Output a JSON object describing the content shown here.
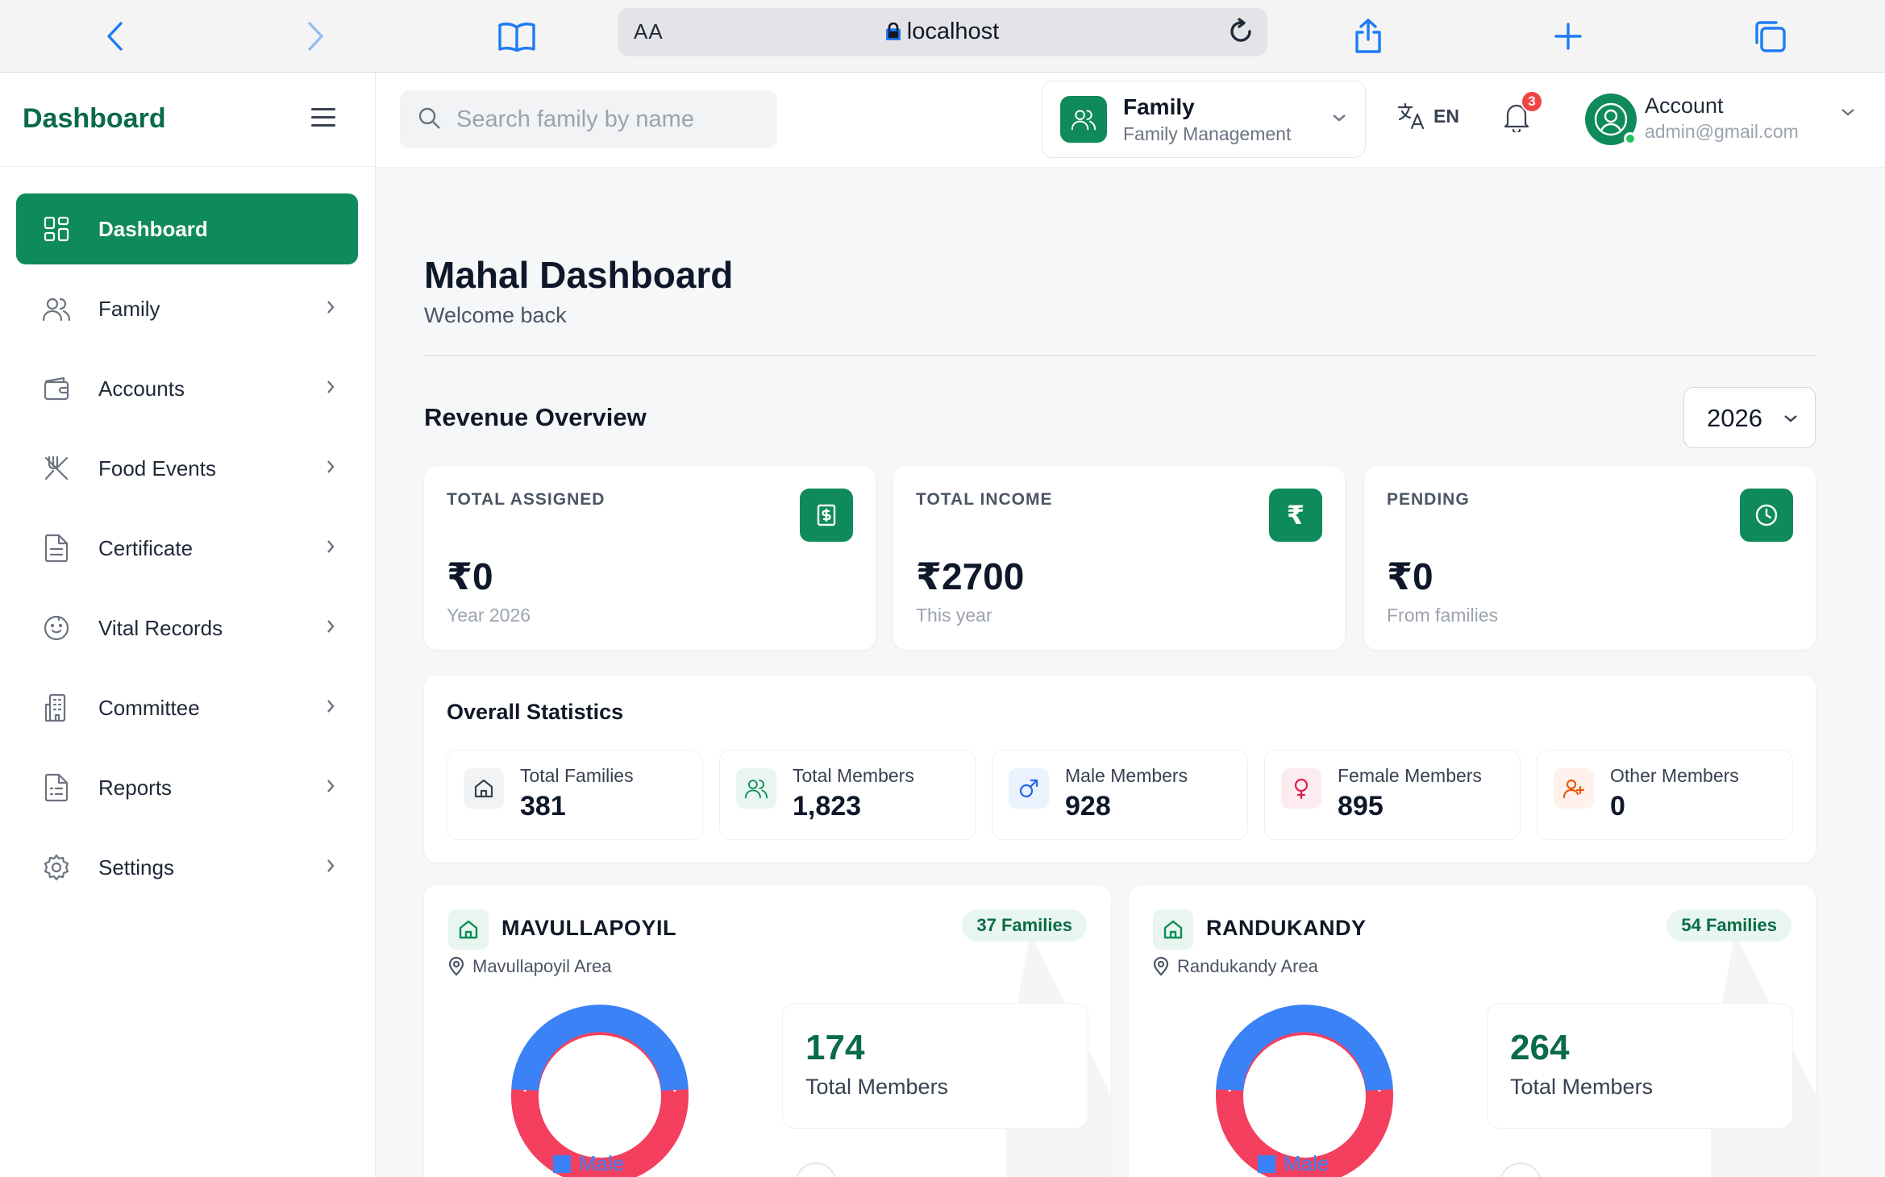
{
  "browser": {
    "aa_label": "AA",
    "url": "localhost"
  },
  "sidebar": {
    "brand": "Dashboard",
    "items": [
      {
        "label": "Dashboard",
        "icon": "grid-icon",
        "active": true
      },
      {
        "label": "Family",
        "icon": "users-icon"
      },
      {
        "label": "Accounts",
        "icon": "wallet-icon"
      },
      {
        "label": "Food Events",
        "icon": "utensils-icon"
      },
      {
        "label": "Certificate",
        "icon": "document-icon"
      },
      {
        "label": "Vital Records",
        "icon": "baby-icon"
      },
      {
        "label": "Committee",
        "icon": "building-icon"
      },
      {
        "label": "Reports",
        "icon": "report-icon"
      },
      {
        "label": "Settings",
        "icon": "gear-icon"
      }
    ]
  },
  "header": {
    "search_placeholder": "Search family by name",
    "module_title": "Family",
    "module_subtitle": "Family Management",
    "language": "EN",
    "notification_count": "3",
    "account_name": "Account",
    "account_email": "admin@gmail.com"
  },
  "page": {
    "title": "Mahal Dashboard",
    "subtitle": "Welcome back"
  },
  "revenue": {
    "title": "Revenue Overview",
    "year": "2026",
    "cards": [
      {
        "label": "TOTAL ASSIGNED",
        "value": "₹0",
        "sub": "Year 2026",
        "icon": "invoice-icon"
      },
      {
        "label": "TOTAL INCOME",
        "value": "₹2700",
        "sub": "This year",
        "icon": "rupee-icon"
      },
      {
        "label": "PENDING",
        "value": "₹0",
        "sub": "From families",
        "icon": "clock-icon"
      }
    ]
  },
  "stats": {
    "title": "Overall Statistics",
    "items": [
      {
        "label": "Total Families",
        "value": "381",
        "icon": "home-icon"
      },
      {
        "label": "Total Members",
        "value": "1,823",
        "icon": "users-icon"
      },
      {
        "label": "Male Members",
        "value": "928",
        "icon": "male-icon"
      },
      {
        "label": "Female Members",
        "value": "895",
        "icon": "female-icon"
      },
      {
        "label": "Other Members",
        "value": "0",
        "icon": "user-plus-icon"
      }
    ]
  },
  "areas": [
    {
      "name": "MAVULLAPOYIL",
      "location": "Mavullapoyil Area",
      "families": "37 Families",
      "members": "174",
      "members_label": "Total Members",
      "legend": "Male"
    },
    {
      "name": "RANDUKANDY",
      "location": "Randukandy Area",
      "families": "54 Families",
      "members": "264",
      "members_label": "Total Members",
      "legend": "Male"
    }
  ],
  "colors": {
    "brand": "#0f8a5b",
    "male": "#3b82f6",
    "female": "#f43f5e"
  }
}
